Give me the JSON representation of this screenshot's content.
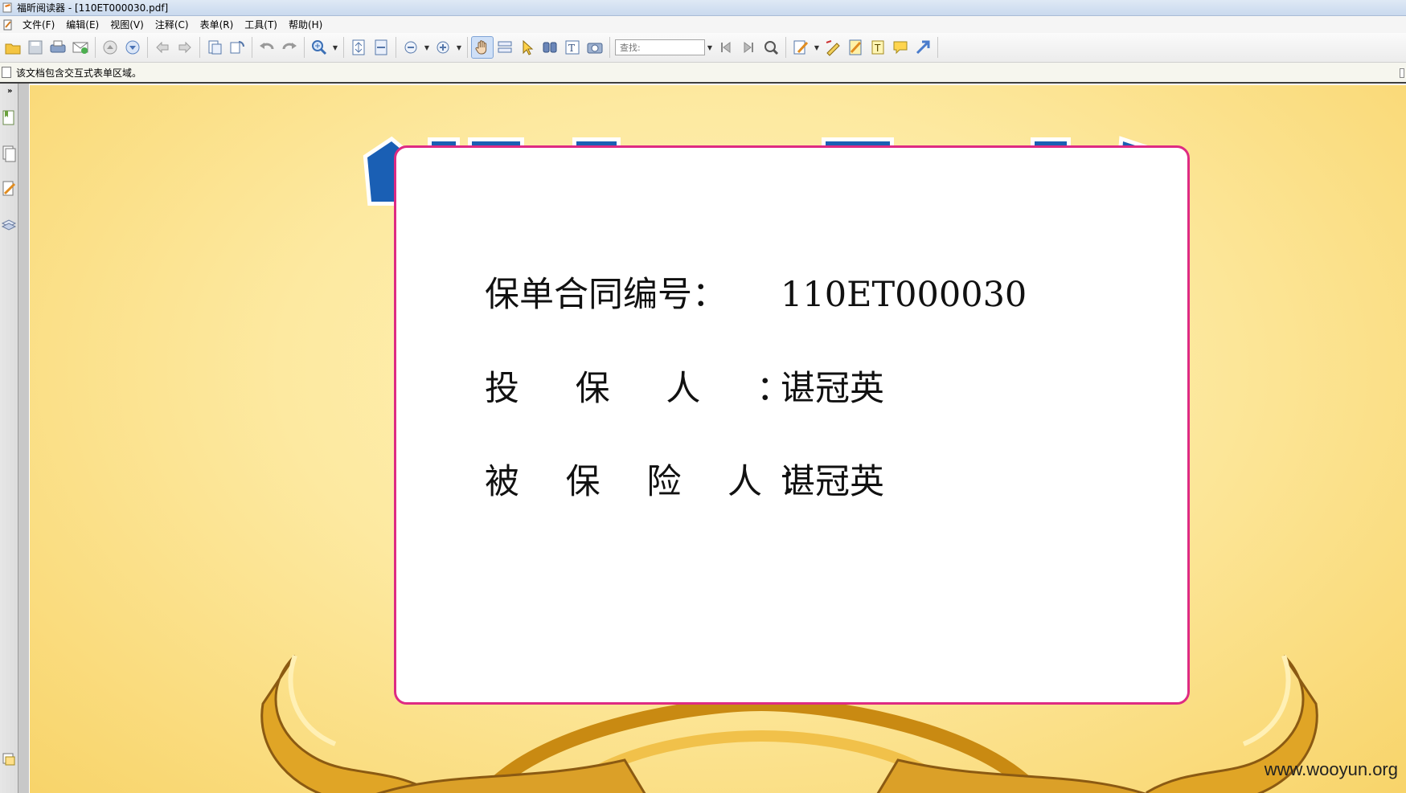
{
  "window": {
    "title": "福昕阅读器 - [110ET000030.pdf]"
  },
  "menu": [
    {
      "label": "文件(F)"
    },
    {
      "label": "编辑(E)"
    },
    {
      "label": "视图(V)"
    },
    {
      "label": "注释(C)"
    },
    {
      "label": "表单(R)"
    },
    {
      "label": "工具(T)"
    },
    {
      "label": "帮助(H)"
    }
  ],
  "toolbar": {
    "search_placeholder": "查找:",
    "icons": [
      "open-icon",
      "save-icon",
      "print-icon",
      "email-icon",
      "prev-page-icon",
      "next-page-icon",
      "back-icon",
      "forward-icon",
      "extract-icon",
      "rotate-icon",
      "undo-icon",
      "redo-icon",
      "zoom-icon",
      "fit-page-icon",
      "fit-width-icon",
      "zoom-out-icon",
      "zoom-in-icon",
      "hand-tool-icon",
      "select-text-icon",
      "select-icon",
      "find-icon",
      "typewriter-icon",
      "snapshot-icon",
      "first-page-icon",
      "last-page-icon",
      "search-icon",
      "pencil-icon",
      "highlight-icon",
      "note-icon",
      "textbox-icon",
      "comment-icon",
      "arrow-icon"
    ]
  },
  "infobar": {
    "message": "该文档包含交互式表单区域。"
  },
  "document": {
    "lines": [
      {
        "label": "保单合同编号：",
        "value": "110ET000030"
      },
      {
        "label": "投 保 人 ：",
        "value": "谌冠英"
      },
      {
        "label": "被 保 险 人：",
        "value": "谌冠英"
      }
    ],
    "watermark": "www.wooyun.org"
  },
  "colors": {
    "card_border": "#de2b83",
    "banner_blue": "#1a5fb4",
    "gold": "#e0a526"
  }
}
